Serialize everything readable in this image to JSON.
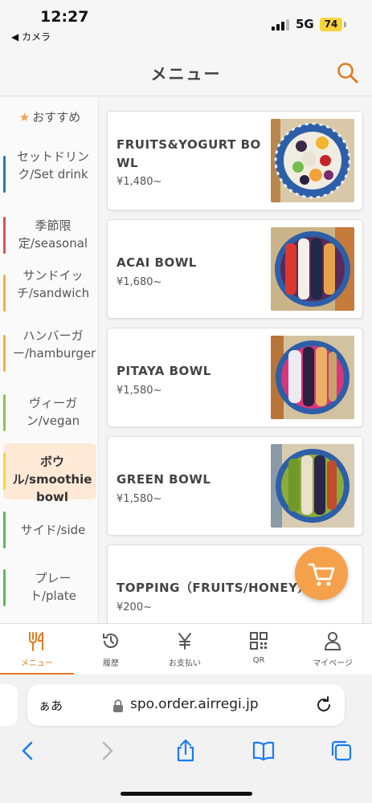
{
  "status": {
    "time": "12:27",
    "back_app": "◀ カメラ",
    "network": "5G",
    "battery": "74"
  },
  "header": {
    "title": "メニュー"
  },
  "sidebar": {
    "recommended": "おすすめ",
    "categories": [
      {
        "label": "セットドリンク/Set drink",
        "color": "#2a7ab0"
      },
      {
        "label": "季節限定/seasonal",
        "color": "#d9534f"
      },
      {
        "label": "サンドイッチ/sandwich",
        "color": "#f0ad4e"
      },
      {
        "label": "ハンバーガー/hamburger",
        "color": "#f0ad4e"
      },
      {
        "label": "ヴィーガン/vegan",
        "color": "#8cc152"
      },
      {
        "label": "ボウル/smoothie bowl",
        "color": "#f7d43a"
      },
      {
        "label": "サイド/side",
        "color": "#5cb85c"
      },
      {
        "label": "プレート/plate",
        "color": "#5cb85c"
      }
    ]
  },
  "products": [
    {
      "name_line1": "FRUITS&YOGURT BO",
      "name_line2": "WL",
      "price": "¥1,480~"
    },
    {
      "name_line1": "ACAI BOWL",
      "name_line2": "",
      "price": "¥1,680~"
    },
    {
      "name_line1": "PITAYA BOWL",
      "name_line2": "",
      "price": "¥1,580~"
    },
    {
      "name_line1": "GREEN BOWL",
      "name_line2": "",
      "price": "¥1,580~"
    },
    {
      "name_line1": "TOPPING（FRUITS/HONEY）",
      "name_line2": "",
      "price": "¥200~"
    }
  ],
  "tabs": [
    {
      "label": "メニュー",
      "icon": "utensils-icon"
    },
    {
      "label": "履歴",
      "icon": "history-icon"
    },
    {
      "label": "お支払い",
      "icon": "yen-icon"
    },
    {
      "label": "QR",
      "icon": "qr-code-icon"
    },
    {
      "label": "マイページ",
      "icon": "person-icon"
    }
  ],
  "browser": {
    "text_size": "ぁあ",
    "url": "spo.order.airregi.jp"
  },
  "colors": {
    "accent": "#e07a20",
    "cart": "#f5a04a",
    "active_category_bg": "#fde9d6"
  }
}
